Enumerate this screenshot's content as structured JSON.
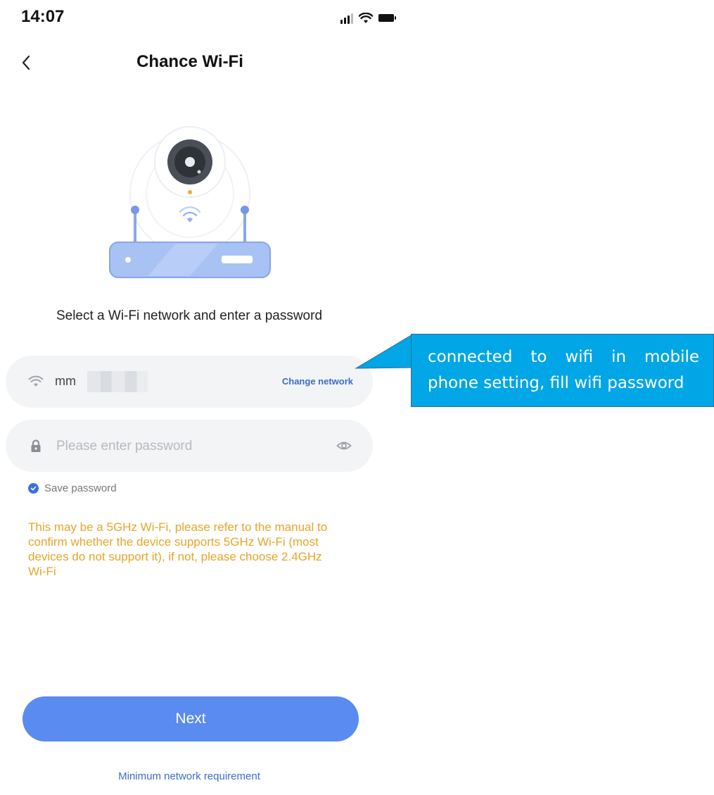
{
  "status_bar": {
    "time": "14:07",
    "icons": [
      "signal-icon",
      "wifi-icon",
      "battery-icon"
    ]
  },
  "header": {
    "title": "Chance Wi-Fi",
    "back_icon": "chevron-left-icon"
  },
  "illustration": {
    "name": "camera-router-illustration"
  },
  "subtitle": "Select a Wi-Fi network and enter a password",
  "ssid_field": {
    "icon": "wifi-icon",
    "value": "mm",
    "change_label": "Change network"
  },
  "password_field": {
    "icon": "lock-icon",
    "placeholder": "Please enter password",
    "value": "",
    "eye_icon": "eye-icon"
  },
  "save_password": {
    "label": "Save password",
    "checked": true
  },
  "warning": "This may be a 5GHz Wi-Fi, please refer to the manual to confirm whether the device supports 5GHz Wi-Fi (most devices do not support it), if not, please choose 2.4GHz Wi-Fi",
  "callout": {
    "text": "connected to wifi in mobile phone setting, fill wifi password"
  },
  "next_button": "Next",
  "min_requirement_link": "Minimum network requirement",
  "colors": {
    "primary": "#5a8bf0",
    "link": "#3b6dc9",
    "warning": "#e6a528",
    "callout": "#00a6e6",
    "field_bg": "#f3f4f6"
  }
}
